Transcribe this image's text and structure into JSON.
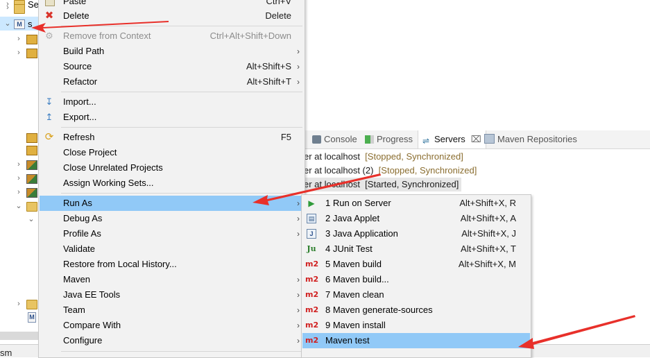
{
  "tree": {
    "rows": [
      {
        "label": "Se"
      },
      {
        "label": "s"
      }
    ]
  },
  "status": {
    "text": "sm"
  },
  "servers_view": {
    "tabs": [
      {
        "label": "Console"
      },
      {
        "label": "Progress"
      },
      {
        "label": "Servers"
      },
      {
        "label": "Maven Repositories"
      }
    ],
    "rows": [
      {
        "name": "er at localhost",
        "state": "[Stopped, Synchronized]"
      },
      {
        "name": "er at localhost (2)",
        "state": "[Stopped, Synchronized]"
      },
      {
        "name": "er at localhost",
        "state": "[Started, Synchronized]"
      }
    ]
  },
  "context_menu": {
    "items": [
      {
        "label": "Paste",
        "accel": "Ctrl+V"
      },
      {
        "label": "Delete",
        "accel": "Delete"
      },
      {
        "label": "Remove from Context",
        "accel": "Ctrl+Alt+Shift+Down"
      },
      {
        "label": "Build Path",
        "accel": ""
      },
      {
        "label": "Source",
        "accel": "Alt+Shift+S"
      },
      {
        "label": "Refactor",
        "accel": "Alt+Shift+T"
      },
      {
        "label": "Import...",
        "accel": ""
      },
      {
        "label": "Export...",
        "accel": ""
      },
      {
        "label": "Refresh",
        "accel": "F5"
      },
      {
        "label": "Close Project",
        "accel": ""
      },
      {
        "label": "Close Unrelated Projects",
        "accel": ""
      },
      {
        "label": "Assign Working Sets...",
        "accel": ""
      },
      {
        "label": "Run As",
        "accel": ""
      },
      {
        "label": "Debug As",
        "accel": ""
      },
      {
        "label": "Profile As",
        "accel": ""
      },
      {
        "label": "Validate",
        "accel": ""
      },
      {
        "label": "Restore from Local History...",
        "accel": ""
      },
      {
        "label": "Maven",
        "accel": ""
      },
      {
        "label": "Java EE Tools",
        "accel": ""
      },
      {
        "label": "Team",
        "accel": ""
      },
      {
        "label": "Compare With",
        "accel": ""
      },
      {
        "label": "Configure",
        "accel": ""
      }
    ]
  },
  "run_as_menu": {
    "items": [
      {
        "label": "1 Run on Server",
        "accel": "Alt+Shift+X, R"
      },
      {
        "label": "2 Java Applet",
        "accel": "Alt+Shift+X, A"
      },
      {
        "label": "3 Java Application",
        "accel": "Alt+Shift+X, J"
      },
      {
        "label": "4 JUnit Test",
        "accel": "Alt+Shift+X, T"
      },
      {
        "label": "5 Maven build",
        "accel": "Alt+Shift+X, M"
      },
      {
        "label": "6 Maven build...",
        "accel": ""
      },
      {
        "label": "7 Maven clean",
        "accel": ""
      },
      {
        "label": "8 Maven generate-sources",
        "accel": ""
      },
      {
        "label": "9 Maven install",
        "accel": ""
      },
      {
        "label": "Maven test",
        "accel": ""
      }
    ]
  },
  "colors": {
    "highlight": "#91c9f7",
    "annotation_arrow": "#e8302a",
    "status_text": "#8a6d2f"
  }
}
